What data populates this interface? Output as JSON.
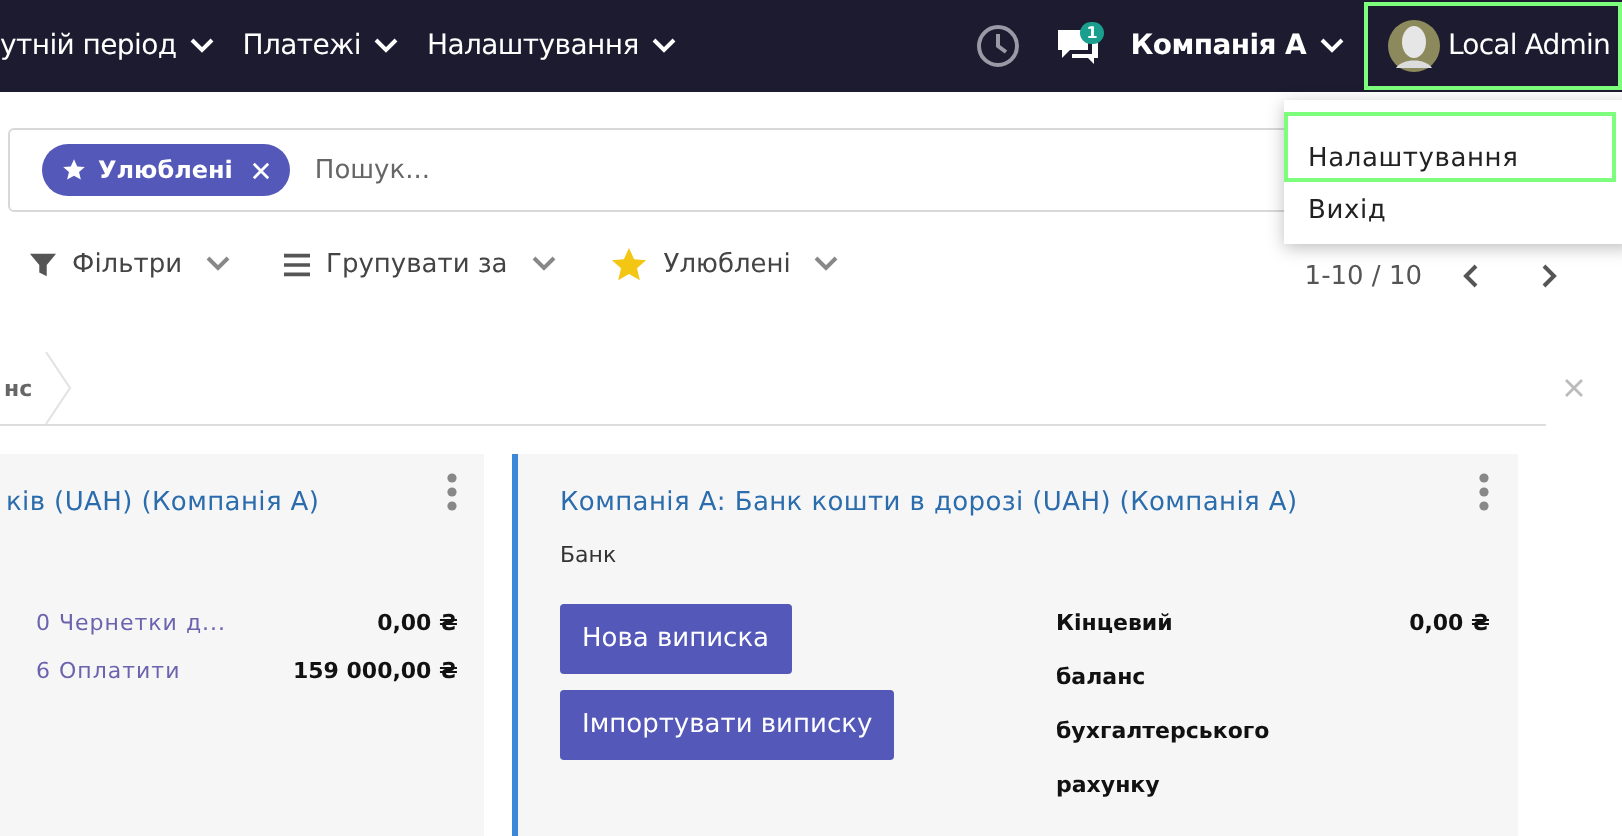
{
  "navbar": {
    "menus": [
      {
        "label": "утній період"
      },
      {
        "label": "Платежі"
      },
      {
        "label": "Налаштування"
      }
    ],
    "messages_badge": "1",
    "company": "Компанія А",
    "user": {
      "name": "Local Admin",
      "highlighted": true
    }
  },
  "user_dropdown": {
    "items": [
      {
        "label": "Налаштування",
        "highlighted": true
      },
      {
        "label": "Вихід",
        "highlighted": false
      }
    ]
  },
  "search": {
    "facet": "Улюблені",
    "placeholder": "Пошук..."
  },
  "toolbar": {
    "filters": "Фільтри",
    "group_by": "Групувати за",
    "favorites": "Улюблені",
    "pager": "1-10 / 10"
  },
  "breadcrumb": "нс",
  "cards": [
    {
      "title": "ків (UAH) (Компанія А)",
      "active": false,
      "rows": [
        {
          "link": "0 Чернетки д...",
          "amount": "0,00 ₴"
        },
        {
          "link": "6 Оплатити",
          "amount": "159 000,00 ₴"
        }
      ]
    },
    {
      "title": "Компанія А: Банк кошти в дорозі (UAH) (Компанія А)",
      "active": true,
      "type": "Банк",
      "buttons": [
        "Нова виписка",
        "Імпортувати виписку"
      ],
      "balance_label": "Кінцевий баланс бухгалтерського рахунку",
      "balance": "0,00 ₴"
    }
  ]
}
